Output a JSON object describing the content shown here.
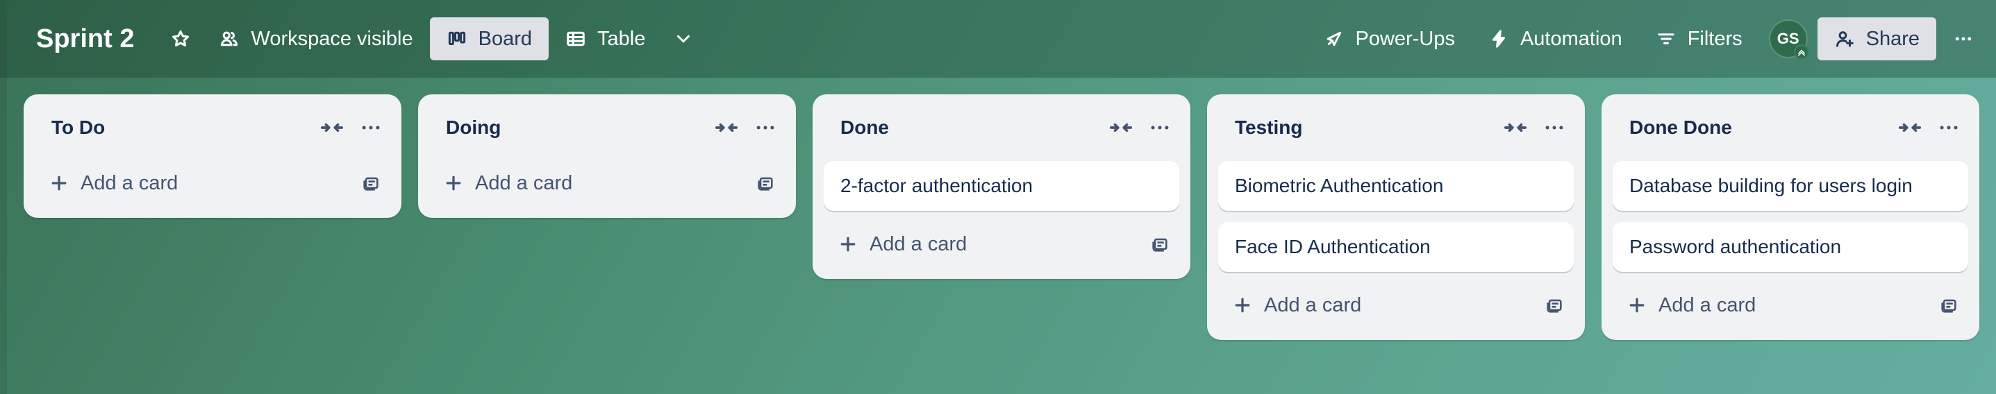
{
  "board": {
    "title": "Sprint 2",
    "visibility_label": "Workspace visible",
    "views": [
      {
        "label": "Board",
        "active": true
      },
      {
        "label": "Table",
        "active": false
      }
    ]
  },
  "header_right": {
    "powerups_label": "Power-Ups",
    "automation_label": "Automation",
    "filters_label": "Filters",
    "avatar_initials": "GS",
    "share_label": "Share"
  },
  "colors": {
    "accent_active_bg": "#dfe1e6",
    "list_bg": "#f1f2f4",
    "card_bg": "#ffffff",
    "text": "#172b4d"
  },
  "add_card_label": "Add a card",
  "lists": [
    {
      "title": "To Do",
      "cards": []
    },
    {
      "title": "Doing",
      "cards": []
    },
    {
      "title": "Done",
      "cards": [
        "2-factor authentication"
      ]
    },
    {
      "title": "Testing",
      "cards": [
        "Biometric Authentication",
        "Face ID Authentication"
      ]
    },
    {
      "title": "Done Done",
      "cards": [
        "Database building for users login",
        "Password authentication"
      ]
    }
  ],
  "icons": {
    "star": "star-icon",
    "visibility": "people-icon",
    "board_view": "board-icon",
    "table_view": "table-icon",
    "views_more": "chevron-down-icon",
    "powerups": "rocket-icon",
    "automation": "lightning-icon",
    "filters": "filter-icon",
    "share": "add-user-icon",
    "collapse": "collapse-icon",
    "list_menu": "more-horizontal-icon",
    "add": "plus-icon",
    "template": "card-template-icon"
  }
}
